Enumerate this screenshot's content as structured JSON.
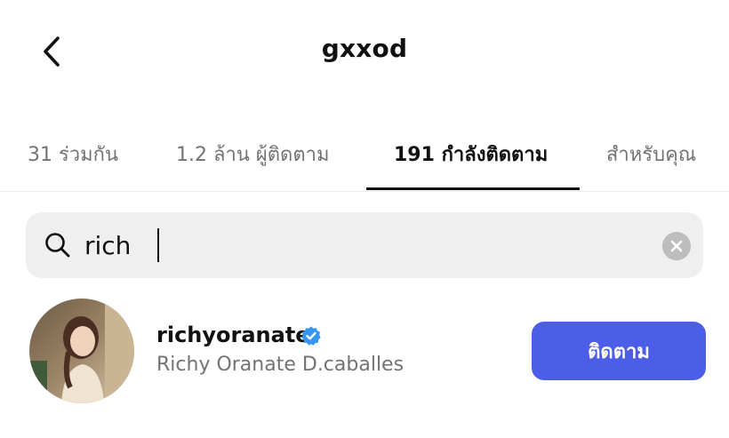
{
  "header": {
    "title": "gxxod",
    "back_icon": "chevron-left-icon"
  },
  "tabs": [
    {
      "label": "31 ร่วมกัน",
      "active": false
    },
    {
      "label": "1.2 ล้าน ผู้ติดตาม",
      "active": false
    },
    {
      "label": "191 กำลังติดตาม",
      "active": true
    },
    {
      "label": "สำหรับคุณ",
      "active": false
    }
  ],
  "search": {
    "value": "rich",
    "icon": "search-icon",
    "clear_icon": "clear-icon"
  },
  "results": [
    {
      "username": "richyoranate",
      "full_name": "Richy Oranate D.caballes",
      "verified": true,
      "follow_label": "ติดตาม"
    }
  ],
  "colors": {
    "accent": "#4c5ee8",
    "verified": "#3797f0",
    "muted_text": "#737373",
    "search_bg": "#efefef"
  }
}
